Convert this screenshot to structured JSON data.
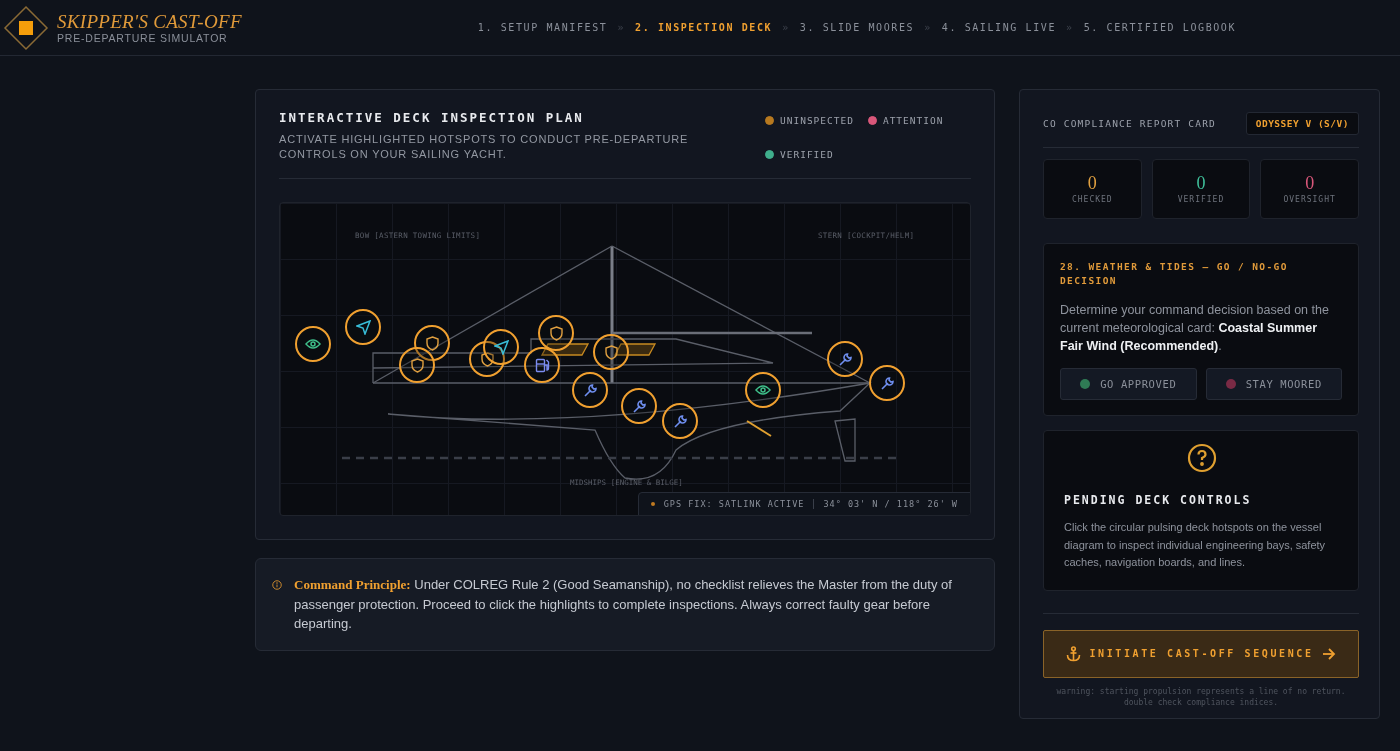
{
  "brand": {
    "title": "SKIPPER'S CAST-OFF",
    "subtitle": "PRE-DEPARTURE SIMULATOR"
  },
  "steps": [
    {
      "label": "1. SETUP MANIFEST",
      "selected": false
    },
    {
      "label": "2. INSPECTION DECK",
      "selected": true
    },
    {
      "label": "3. SLIDE MOORES",
      "selected": false
    },
    {
      "label": "4. SAILING LIVE",
      "selected": false
    },
    {
      "label": "5. CERTIFIED LOGBOOK",
      "selected": false
    }
  ],
  "step_separator": "»",
  "plan": {
    "title": "INTERACTIVE DECK INSPECTION PLAN",
    "subtitle": "ACTIVATE HIGHLIGHTED HOTSPOTS TO CONDUCT PRE-DEPARTURE CONTROLS ON YOUR SAILING YACHT.",
    "legend": [
      {
        "label": "UNINSPECTED",
        "color": "#b7791f"
      },
      {
        "label": "ATTENTION",
        "color": "#d9577a"
      },
      {
        "label": "VERIFIED",
        "color": "#3fae8c"
      }
    ],
    "diagram": {
      "bow_label": "BOW [ASTERN TOWING LIMITS]",
      "stern_label": "STERN [COCKPIT/HELM]",
      "midships_label": "MIDSHIPS [ENGINE & BILGE]",
      "hotspots": [
        {
          "kind": "eye"
        },
        {
          "kind": "navigation"
        },
        {
          "kind": "shield"
        },
        {
          "kind": "shield"
        },
        {
          "kind": "shield"
        },
        {
          "kind": "navigation"
        },
        {
          "kind": "fuel"
        },
        {
          "kind": "shield"
        },
        {
          "kind": "shield"
        },
        {
          "kind": "wrench"
        },
        {
          "kind": "wrench"
        },
        {
          "kind": "wrench"
        },
        {
          "kind": "eye"
        },
        {
          "kind": "wrench"
        },
        {
          "kind": "wrench"
        }
      ],
      "gps_status": "GPS FIX: SATLINK ACTIVE",
      "gps_position": "34° 03' N / 118° 26' W"
    }
  },
  "principle": {
    "text": "**Command Principle:** Under COLREG Rule 2 (Good Seamanship), no checklist relieves the Master from the duty of passenger protection. Proceed to click the highlights to complete inspections. Always correct faulty gear before departing."
  },
  "report": {
    "title": "CO COMPLIANCE REPORT CARD",
    "vessel": "ODYSSEY V (S/V)",
    "stats": [
      {
        "value": "0",
        "label": "CHECKED",
        "color": "#e0a040"
      },
      {
        "value": "0",
        "label": "VERIFIED",
        "color": "#3fbf9a"
      },
      {
        "value": "0",
        "label": "OVERSIGHT",
        "color": "#d9577a"
      }
    ],
    "decision": {
      "title": "28. WEATHER & TIDES — GO / NO-GO DECISION",
      "text": "Determine your command decision based on the current meteorological card: **Coastal Summer Fair Wind (Recommended)**.",
      "options": [
        {
          "label": "GO APPROVED",
          "color": "#2f7a55"
        },
        {
          "label": "STAY MOORED",
          "color": "#7a2a45"
        }
      ]
    },
    "pending": {
      "title": "PENDING DECK CONTROLS",
      "text": "Click the circular pulsing deck hotspots on the vessel diagram to inspect individual engineering bays, safety caches, navigation boards, and lines."
    },
    "action": "INITIATE CAST-OFF SEQUENCE",
    "warning": "warning: starting propulsion represents a line of no return. double check compliance indices."
  }
}
